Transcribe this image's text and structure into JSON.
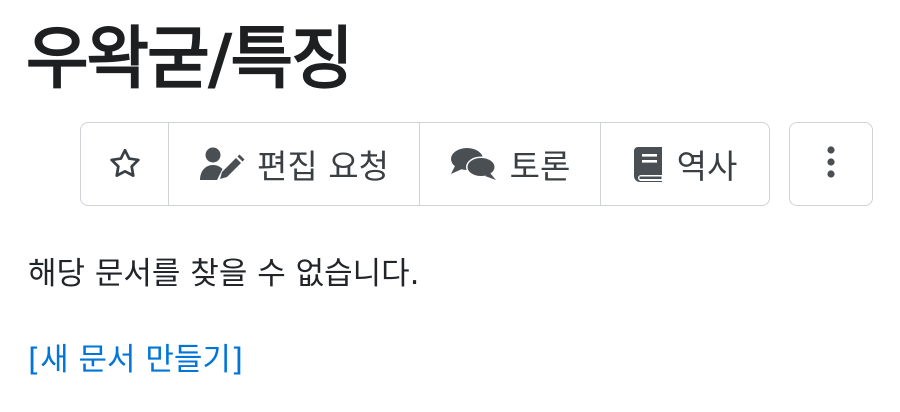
{
  "page": {
    "title": "우왁굳/특징"
  },
  "toolbar": {
    "star_icon": "star-outline-icon",
    "edit_request_label": "편집 요청",
    "edit_request_icon": "user-edit-icon",
    "discussion_label": "토론",
    "discussion_icon": "comments-icon",
    "history_label": "역사",
    "history_icon": "book-icon",
    "more_icon": "vertical-ellipsis-icon"
  },
  "content": {
    "not_found_message": "해당 문서를 찾을 수 없습니다.",
    "create_link_label": "[새 문서 만들기]"
  },
  "colors": {
    "link": "#0275d8",
    "border": "#cfd3d7",
    "icon": "#4a4f54",
    "text": "#212529"
  }
}
